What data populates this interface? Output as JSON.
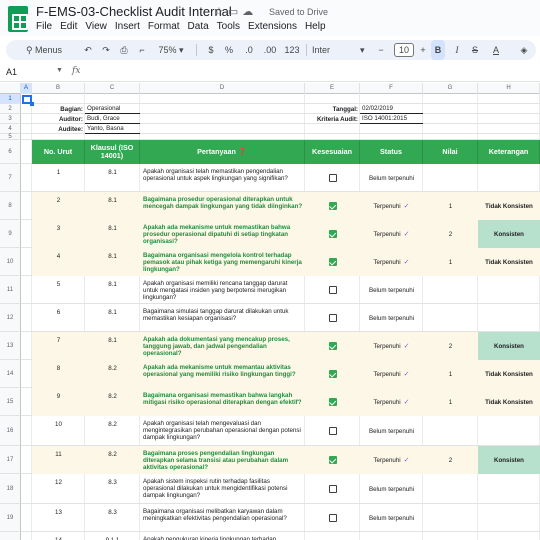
{
  "app": {
    "doc_title": "F-EMS-03-Checklist Audit Internal",
    "saved_status": "Saved to Drive",
    "menus": [
      "File",
      "Edit",
      "View",
      "Insert",
      "Format",
      "Data",
      "Tools",
      "Extensions",
      "Help"
    ]
  },
  "toolbar": {
    "menus_label": "Menus",
    "zoom": "75%",
    "currency": "$",
    "percent": "%",
    "decimal_dec": ".0",
    "decimal_inc": ".00",
    "number_format": "123",
    "font": "Inter",
    "font_size": "10",
    "bold": "B",
    "italic": "I",
    "strike": "S",
    "text_color": "A"
  },
  "formula_bar": {
    "cell_ref": "A1",
    "fx": "fx",
    "value": ""
  },
  "columns": [
    "A",
    "B",
    "C",
    "D",
    "E",
    "F",
    "G",
    "H"
  ],
  "row_numbers": [
    "1",
    "2",
    "3",
    "4",
    "5",
    "6",
    "7",
    "8",
    "9",
    "10",
    "11",
    "12",
    "13",
    "14",
    "15",
    "16",
    "17",
    "18",
    "19",
    "20"
  ],
  "info": {
    "bagian_label": "Bagian:",
    "bagian": "Operasional",
    "auditor_label": "Auditor:",
    "auditor": "Budi, Grace",
    "auditee_label": "Auditee:",
    "auditee": "Yanto, Basna",
    "tanggal_label": "Tanggal:",
    "tanggal": "02/02/2019",
    "kriteria_label": "Kriteria Audit:",
    "kriteria": "ISO 14001:2015"
  },
  "table_headers": {
    "no": "No. Urut",
    "klausul": "Klausul (ISO 14001)",
    "pertanyaan": "Pertanyaan ❓",
    "kesesuaian": "Kesesuaian",
    "status": "Status",
    "nilai": "Nilai",
    "keterangan": "Keterangan"
  },
  "rows": [
    {
      "no": "1",
      "klausul": "8.1",
      "q": "Apakah organisasi telah memastikan pengendalian operasional untuk aspek lingkungan yang signifikan?",
      "checked": false,
      "status": "Belum terpenuhi",
      "nilai": "",
      "ket": ""
    },
    {
      "no": "2",
      "klausul": "8.1",
      "q": "Bagaimana prosedur operasional diterapkan untuk mencegah dampak lingkungan yang tidak diinginkan?",
      "checked": true,
      "status": "Terpenuhi",
      "nilai": "1",
      "ket": "Tidak Konsisten"
    },
    {
      "no": "3",
      "klausul": "8.1",
      "q": "Apakah ada mekanisme untuk memastikan bahwa prosedur operasional dipatuhi di setiap tingkatan organisasi?",
      "checked": true,
      "status": "Terpenuhi",
      "nilai": "2",
      "ket": "Konsisten"
    },
    {
      "no": "4",
      "klausul": "8.1",
      "q": "Bagaimana organisasi mengelola kontrol terhadap pemasok atau pihak ketiga yang memengaruhi kinerja lingkungan?",
      "checked": true,
      "status": "Terpenuhi",
      "nilai": "1",
      "ket": "Tidak Konsisten"
    },
    {
      "no": "5",
      "klausul": "8.1",
      "q": "Apakah organisasi memiliki rencana tanggap darurat untuk mengatasi insiden yang berpotensi merugikan lingkungan?",
      "checked": false,
      "status": "Belum terpenuhi",
      "nilai": "",
      "ket": ""
    },
    {
      "no": "6",
      "klausul": "8.1",
      "q": "Bagaimana simulasi tanggap darurat dilakukan untuk memastikan kesiapan organisasi?",
      "checked": false,
      "status": "Belum terpenuhi",
      "nilai": "",
      "ket": ""
    },
    {
      "no": "7",
      "klausul": "8.1",
      "q": "Apakah ada dokumentasi yang mencakup proses, tanggung jawab, dan jadwal pengendalian operasional?",
      "checked": true,
      "status": "Terpenuhi",
      "nilai": "2",
      "ket": "Konsisten"
    },
    {
      "no": "8",
      "klausul": "8.2",
      "q": "Apakah ada mekanisme untuk memantau aktivitas operasional yang memiliki risiko lingkungan tinggi?",
      "checked": true,
      "status": "Terpenuhi",
      "nilai": "1",
      "ket": "Tidak Konsisten"
    },
    {
      "no": "9",
      "klausul": "8.2",
      "q": "Bagaimana organisasi memastikan bahwa langkah mitigasi risiko operasional diterapkan dengan efektif?",
      "checked": true,
      "status": "Terpenuhi",
      "nilai": "1",
      "ket": "Tidak Konsisten"
    },
    {
      "no": "10",
      "klausul": "8.2",
      "q": "Apakah organisasi telah mengevaluasi dan mengintegrasikan perubahan operasional dengan potensi dampak lingkungan?",
      "checked": false,
      "status": "Belum terpenuhi",
      "nilai": "",
      "ket": ""
    },
    {
      "no": "11",
      "klausul": "8.2",
      "q": "Bagaimana proses pengendalian lingkungan diterapkan selama transisi atau perubahan dalam aktivitas operasional?",
      "checked": true,
      "status": "Terpenuhi",
      "nilai": "2",
      "ket": "Konsisten"
    },
    {
      "no": "12",
      "klausul": "8.3",
      "q": "Apakah sistem inspeksi rutin terhadap fasilitas operasional dilakukan untuk mengidentifikasi potensi dampak lingkungan?",
      "checked": false,
      "status": "Belum terpenuhi",
      "nilai": "",
      "ket": ""
    },
    {
      "no": "13",
      "klausul": "8.3",
      "q": "Bagaimana organisasi melibatkan karyawan dalam meningkatkan efektivitas pengendalian operasional?",
      "checked": false,
      "status": "Belum terpenuhi",
      "nilai": "",
      "ket": ""
    },
    {
      "no": "14",
      "klausul": "9.1.1",
      "q": "Apakah pengukuran kinerja lingkungan terhadap",
      "checked": false,
      "status": "",
      "nilai": "",
      "ket": ""
    }
  ]
}
